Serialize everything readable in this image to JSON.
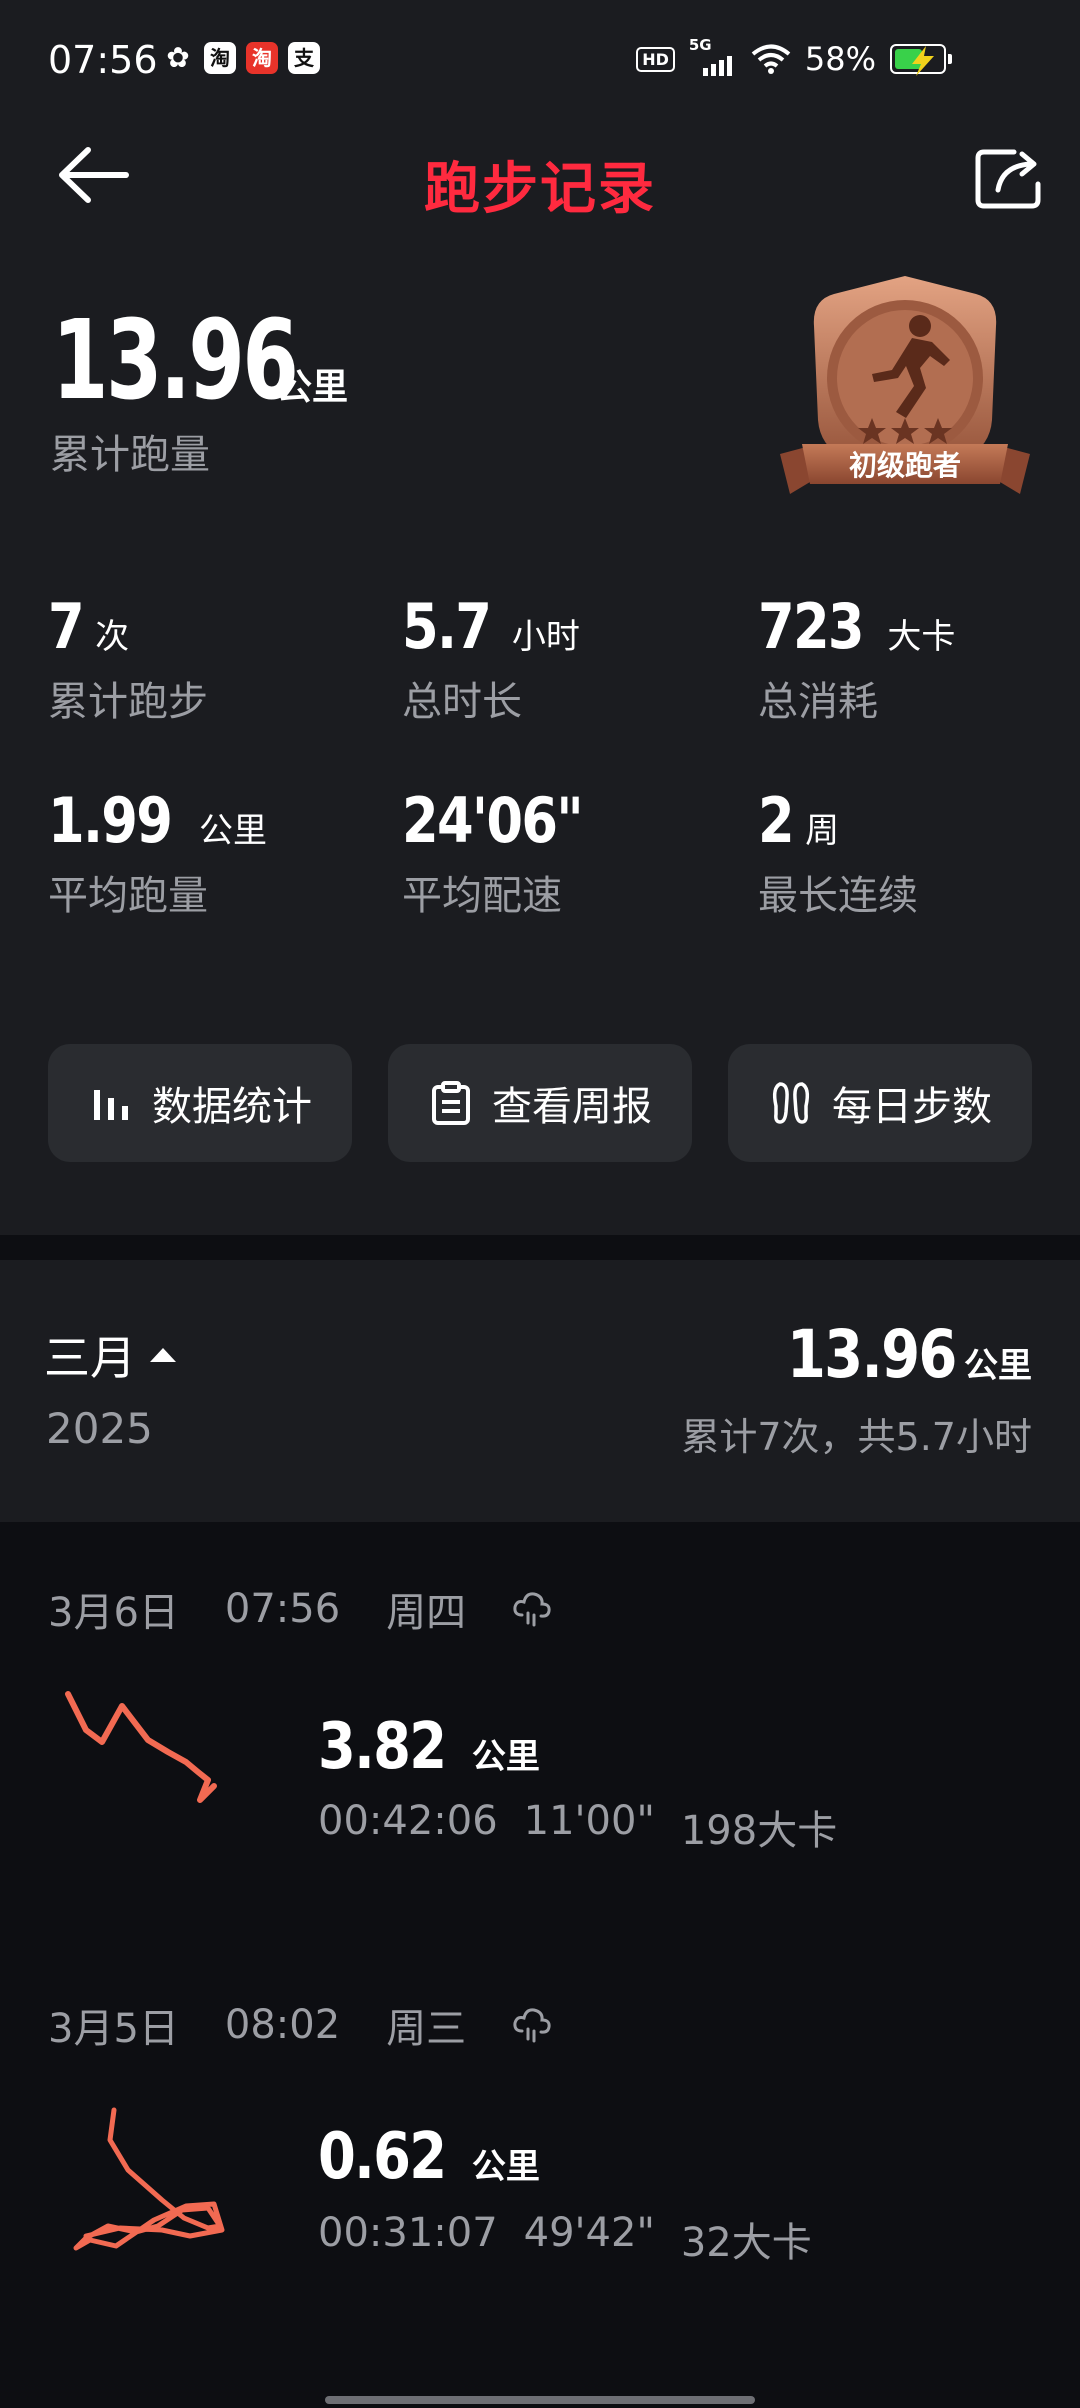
{
  "status_bar": {
    "time": "07:56",
    "app_icons": [
      "wechat-icon",
      "taobao-icon",
      "taobao-lite-icon",
      "alipay-icon"
    ],
    "network": "5G",
    "hd": "HD",
    "battery_percent": "58%",
    "battery_level": 0.58
  },
  "header": {
    "title": "跑步记录",
    "title_color": "#ff2a3f"
  },
  "summary": {
    "total_distance": "13.96",
    "total_unit": "公里",
    "total_label": "累计跑量",
    "badge_label": "初级跑者",
    "stats": [
      {
        "value": "7",
        "unit": "次",
        "label": "累计跑步"
      },
      {
        "value": "5.7",
        "unit": "小时",
        "label": "总时长"
      },
      {
        "value": "723",
        "unit": "大卡",
        "label": "总消耗"
      },
      {
        "value": "1.99",
        "unit": "公里",
        "label": "平均跑量"
      },
      {
        "value": "24'06\"",
        "unit": "",
        "label": "平均配速"
      },
      {
        "value": "2",
        "unit": "周",
        "label": "最长连续"
      }
    ],
    "actions": [
      {
        "label": "数据统计",
        "icon": "bar-chart-icon"
      },
      {
        "label": "查看周报",
        "icon": "clipboard-icon"
      },
      {
        "label": "每日步数",
        "icon": "footprints-icon"
      }
    ]
  },
  "month": {
    "month": "三月",
    "year": "2025",
    "total": "13.96",
    "unit": "公里",
    "subtitle": "累计7次，共5.7小时"
  },
  "records": [
    {
      "date": "3月6日",
      "time": "07:56",
      "weekday": "周四",
      "weather_icon": "cloud-icon",
      "distance": "3.82",
      "unit": "公里",
      "duration": "00:42:06",
      "pace": "11'00\"",
      "calories": "198大卡"
    },
    {
      "date": "3月5日",
      "time": "08:02",
      "weekday": "周三",
      "weather_icon": "cloud-icon",
      "distance": "0.62",
      "unit": "公里",
      "duration": "00:31:07",
      "pace": "49'42\"",
      "calories": "32大卡"
    }
  ]
}
